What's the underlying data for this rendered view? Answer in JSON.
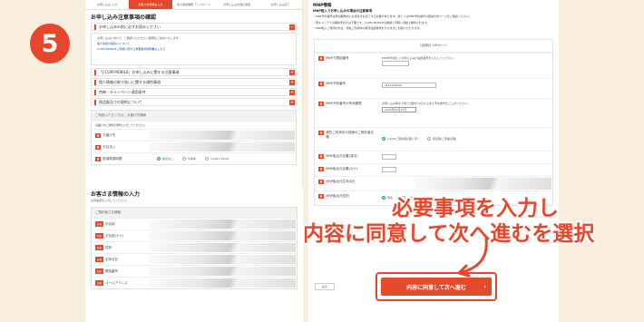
{
  "step_number": "5",
  "steps": [
    "お申し込み 入力",
    "お客さま情報を入力",
    "本人確認書類 アップロード",
    "お申し込み内容の確認",
    "お申し込み完了"
  ],
  "left": {
    "section_title": "お申し込み注意事項の確認",
    "bars": [
      {
        "label": "お申し込みの前に必ずお読みください",
        "open": true
      },
      {
        "label": "「J:COM MOBILE」お申し込みに関する注意事項"
      },
      {
        "label": "個人情報の取り扱いに関する規約事項"
      },
      {
        "label": "特典・キャンペーン適用条件"
      },
      {
        "label": "個品販売での契約について"
      }
    ],
    "notice_text": "お申し込みにあたり、ご確認いただきたい事項をご案内いたします。",
    "notice_links": [
      "個人情報の取扱いについて",
      "J:COM MOBILEご利用に関する重要事項説明書はこちら"
    ],
    "form_header": "ご利用いただく方の、お届け先情報",
    "form_note": "お届けのご希望日時を入力してください。",
    "rows": [
      {
        "label": "お届け先"
      },
      {
        "label": "お住まい"
      },
      {
        "label": "配達希望時間"
      }
    ],
    "time_options": [
      "指定なし",
      "午前中",
      "14:00〜16:00",
      "16:00〜18:00",
      "18:00〜20:00",
      "19:00〜21:00"
    ]
  },
  "customer": {
    "title": "お客さま情報の入力",
    "subtitle": "必須事項を入力してください。",
    "form_header": "ご契約者さま情報",
    "required_badge": "必須",
    "rows": [
      "お名前",
      "お名前(カナ)",
      "性別",
      "生年月日",
      "電話番号",
      "メールアドレス"
    ]
  },
  "right": {
    "head": "MNP情報",
    "title": "MNP転入でお申し込みの場合の注意事項",
    "bullets": [
      "・MNP予約番号は有効期限内にお手続きを完了する必要があります。詳しくはMNP予約番号の取得方法ページをご確認ください。",
      "・現キャリアでの解約手続きは不要です。J:COM MOBILEの開通と同時に自動で解約されます。",
      "・MNP転入ご希望の方は、現在ご利用中の携帯電話番号をそのままご利用いただけます。"
    ],
    "box_caption": "1回線目 SIMカード",
    "rows": [
      {
        "label": "MNP元電話番号",
        "note": "MNPを利用してお申し込みの電話番号を入力してください。"
      },
      {
        "label": "MNP予約番号",
        "value": "1111111111"
      },
      {
        "label": "MNP予約番号の有効期限",
        "note": "お申し込み時点で残り日数が10日以上ある予約番号をご入力ください。",
        "select": "2023年05月31日"
      },
      {
        "label": "現在ご利用中の回線のご契約者名義",
        "options": [
          "J:COMご契約者名義と同一",
          "別名義(ご家族名義)"
        ]
      },
      {
        "label": "MNP転出元名義(漢字)"
      },
      {
        "label": "MNP転出元名義(カナ)"
      },
      {
        "label": "MNP転出元生年月日"
      },
      {
        "label": "MNP転出元性別",
        "options": [
          "男性",
          "女性"
        ]
      }
    ],
    "back_label": "戻る",
    "submit_label": "内容に同意して次へ進む"
  },
  "annotation": {
    "line1": "必要事項を入力し",
    "line2": "内容に同意して次へ進むを選択"
  },
  "colors": {
    "accent": "#e34a2c",
    "background": "#f9eede"
  }
}
